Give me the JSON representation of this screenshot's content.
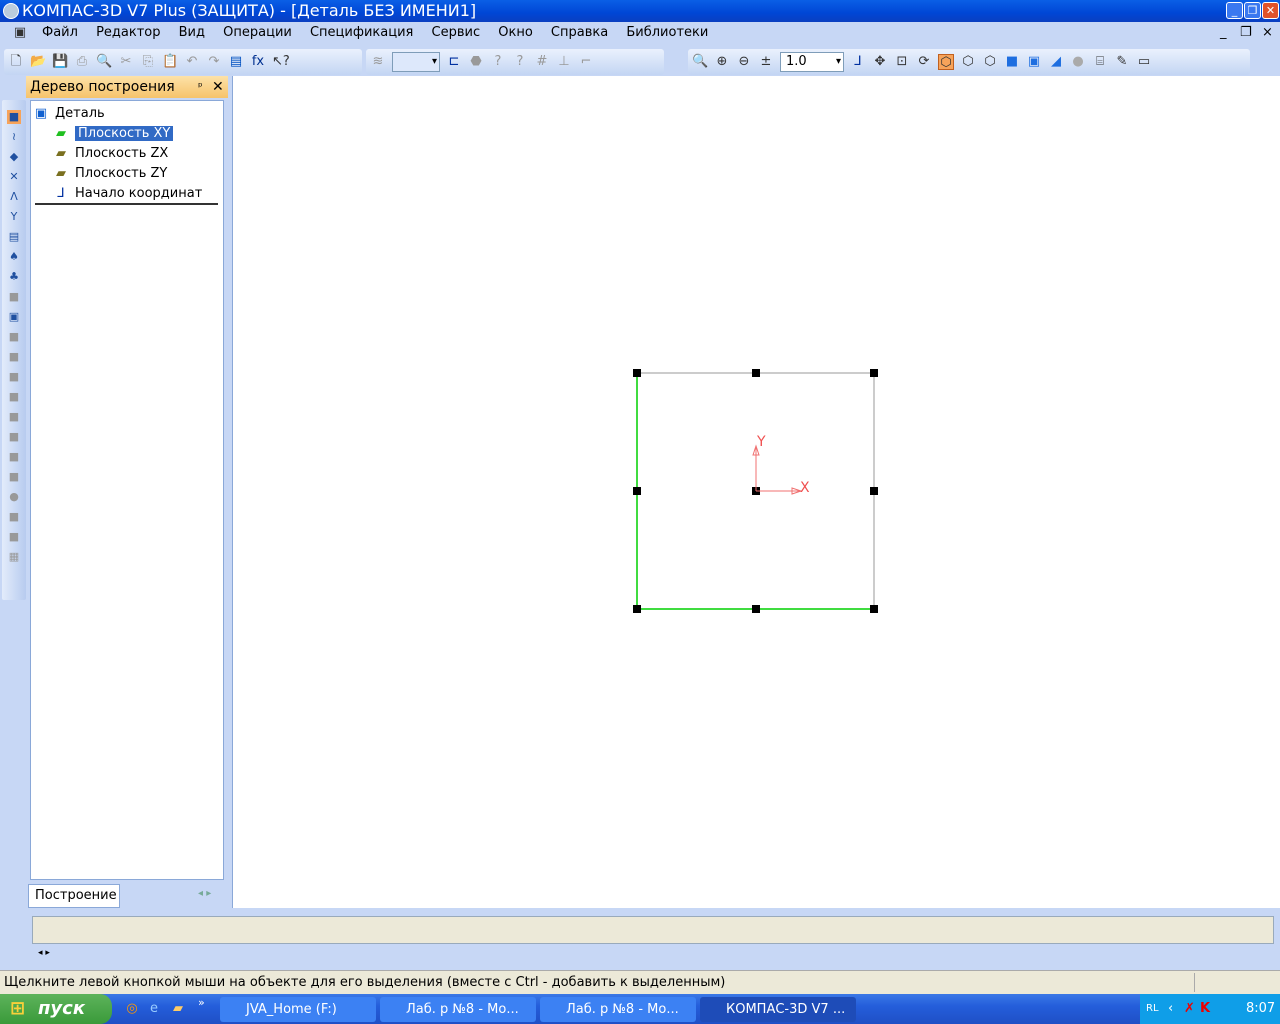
{
  "window": {
    "title": "КОМПАС-3D V7 Plus (ЗАЩИТА) - [Деталь БЕЗ ИМЕНИ1]"
  },
  "menu": [
    "Файл",
    "Редактор",
    "Вид",
    "Операции",
    "Спецификация",
    "Сервис",
    "Окно",
    "Справка",
    "Библиотеки"
  ],
  "toolbar": {
    "zoom_value": "1.0"
  },
  "tree_panel": {
    "title": "Дерево построения",
    "root": "Деталь",
    "items": [
      "Плоскость XY",
      "Плоскость ZX",
      "Плоскость ZY",
      "Начало координат"
    ],
    "selected": "Плоскость XY",
    "tab": "Построение"
  },
  "canvas": {
    "axis_x": "X",
    "axis_y": "Y"
  },
  "status": {
    "hint": "Щелкните левой кнопкой мыши на объекте для его выделения (вместе с Ctrl - добавить к выделенным)"
  },
  "taskbar": {
    "start": "пуск",
    "tasks": [
      "JVA_Home (F:)",
      "Лаб. р №8 - Мо...",
      "Лаб. р №8 - Мо...",
      "КОМПАС-3D V7 ..."
    ],
    "lang": "RL",
    "clock": "8:07"
  }
}
